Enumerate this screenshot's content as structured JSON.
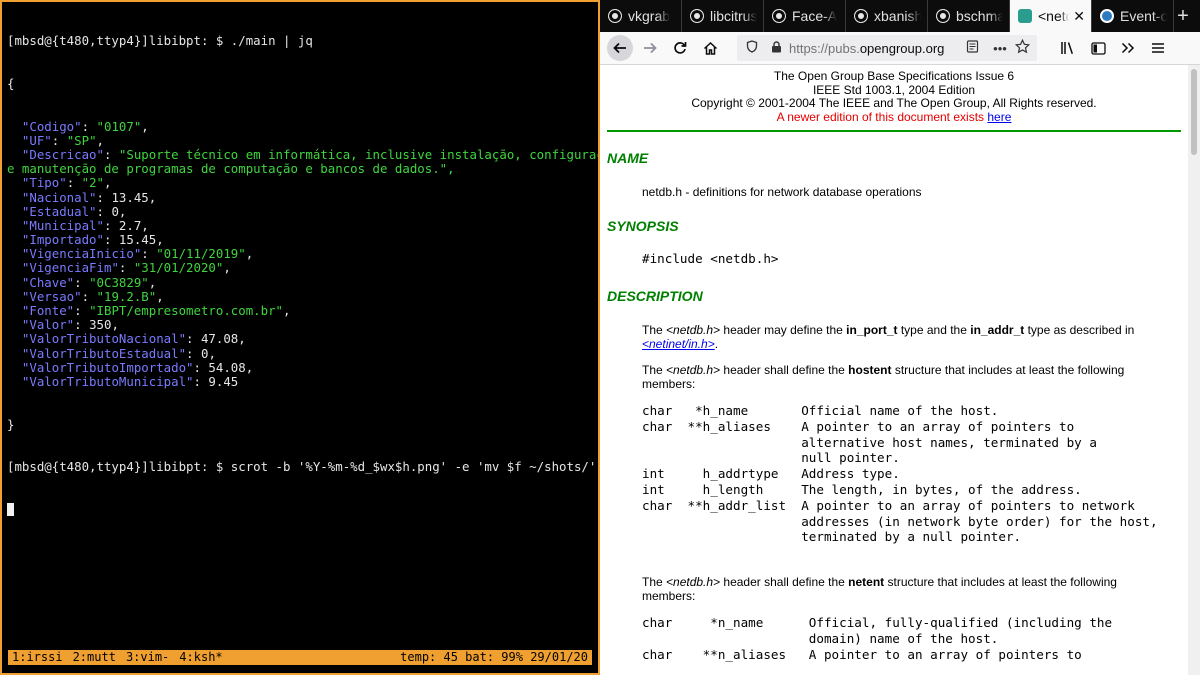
{
  "terminal": {
    "prompt1": "[mbsd@{t480,ttyp4}]libibpt: $ ./main | jq",
    "json_open": "{",
    "fields": [
      {
        "key": "\"Codigo\"",
        "val": "\"0107\"",
        "type": "s"
      },
      {
        "key": "\"UF\"",
        "val": "\"SP\"",
        "type": "s"
      },
      {
        "key": "\"Descricao\"",
        "val": "\"Suporte técnico em informática, inclusive instalação, configuração",
        "type": "s",
        "cont": "e manutenção de programas de computação e bancos de dados.\","
      },
      {
        "key": "\"Tipo\"",
        "val": "\"2\"",
        "type": "s"
      },
      {
        "key": "\"Nacional\"",
        "val": "13.45",
        "type": "n"
      },
      {
        "key": "\"Estadual\"",
        "val": "0",
        "type": "n"
      },
      {
        "key": "\"Municipal\"",
        "val": "2.7",
        "type": "n"
      },
      {
        "key": "\"Importado\"",
        "val": "15.45",
        "type": "n"
      },
      {
        "key": "\"VigenciaInicio\"",
        "val": "\"01/11/2019\"",
        "type": "s"
      },
      {
        "key": "\"VigenciaFim\"",
        "val": "\"31/01/2020\"",
        "type": "s"
      },
      {
        "key": "\"Chave\"",
        "val": "\"0C3829\"",
        "type": "s"
      },
      {
        "key": "\"Versao\"",
        "val": "\"19.2.B\"",
        "type": "s"
      },
      {
        "key": "\"Fonte\"",
        "val": "\"IBPT/empresometro.com.br\"",
        "type": "s"
      },
      {
        "key": "\"Valor\"",
        "val": "350",
        "type": "n"
      },
      {
        "key": "\"ValorTributoNacional\"",
        "val": "47.08",
        "type": "n"
      },
      {
        "key": "\"ValorTributoEstadual\"",
        "val": "0",
        "type": "n"
      },
      {
        "key": "\"ValorTributoImportado\"",
        "val": "54.08",
        "type": "n"
      },
      {
        "key": "\"ValorTributoMunicipal\"",
        "val": "9.45",
        "type": "n",
        "last": true
      }
    ],
    "json_close": "}",
    "prompt2": "[mbsd@{t480,ttyp4}]libibpt: $ scrot -b '%Y-%m-%d_$wx$h.png' -e 'mv $f ~/shots/'",
    "status": {
      "windows": [
        "1:irssi",
        "2:mutt",
        "3:vim-",
        "4:ksh*"
      ],
      "right": "temp: 45 bat: 99% 29/01/20"
    }
  },
  "browser": {
    "tabs": [
      {
        "label": "vkgrab",
        "icon": "github-icon"
      },
      {
        "label": "libcitrus",
        "icon": "github-icon"
      },
      {
        "label": "Face-A",
        "icon": "github-icon"
      },
      {
        "label": "xbanish",
        "icon": "github-icon"
      },
      {
        "label": "bschmal",
        "icon": "github-icon"
      },
      {
        "label": "<netdb.h>",
        "icon": "opengroup-icon",
        "active": true
      },
      {
        "label": "Event-o",
        "icon": "wordpress-icon"
      }
    ],
    "url_prefix": "https://pubs.",
    "url_host": "opengroup.org",
    "page": {
      "header_line1": "The Open Group Base Specifications Issue 6",
      "header_line2": "IEEE Std 1003.1, 2004 Edition",
      "header_line3": "Copyright © 2001-2004 The IEEE and The Open Group, All Rights reserved.",
      "newer_edition": "A newer edition of this document exists",
      "newer_link": "here",
      "h_name": "NAME",
      "name_text": "netdb.h - definitions for network database operations",
      "h_synopsis": "SYNOPSIS",
      "synopsis_code": "#include <netdb.h>",
      "h_description": "DESCRIPTION",
      "desc1_a": "The ",
      "desc1_hdr": "<netdb.h>",
      "desc1_b": " header may define the ",
      "desc1_t1": "in_port_t",
      "desc1_c": " type and the ",
      "desc1_t2": "in_addr_t",
      "desc1_d": " type as described in",
      "desc1_link": "<netinet/in.h>",
      "desc1_end": ".",
      "desc2_a": "The ",
      "desc2_hdr": "<netdb.h>",
      "desc2_b": " header shall define the ",
      "desc2_s": "hostent",
      "desc2_c": " structure that includes at least the following members:",
      "hostent_members": [
        "char   *h_name       Official name of the host.",
        "char  **h_aliases    A pointer to an array of pointers to",
        "                     alternative host names, terminated by a",
        "                     null pointer.",
        "int     h_addrtype   Address type.",
        "int     h_length     The length, in bytes, of the address.",
        "char  **h_addr_list  A pointer to an array of pointers to network",
        "                     addresses (in network byte order) for the host,",
        "                     terminated by a null pointer."
      ],
      "desc3_a": "The ",
      "desc3_hdr": "<netdb.h>",
      "desc3_b": " header shall define the ",
      "desc3_s": "netent",
      "desc3_c": " structure that includes at least the following members:",
      "netent_members": [
        "char     *n_name      Official, fully-qualified (including the",
        "                      domain) name of the host.",
        "char    **n_aliases   A pointer to an array of pointers to"
      ]
    }
  }
}
